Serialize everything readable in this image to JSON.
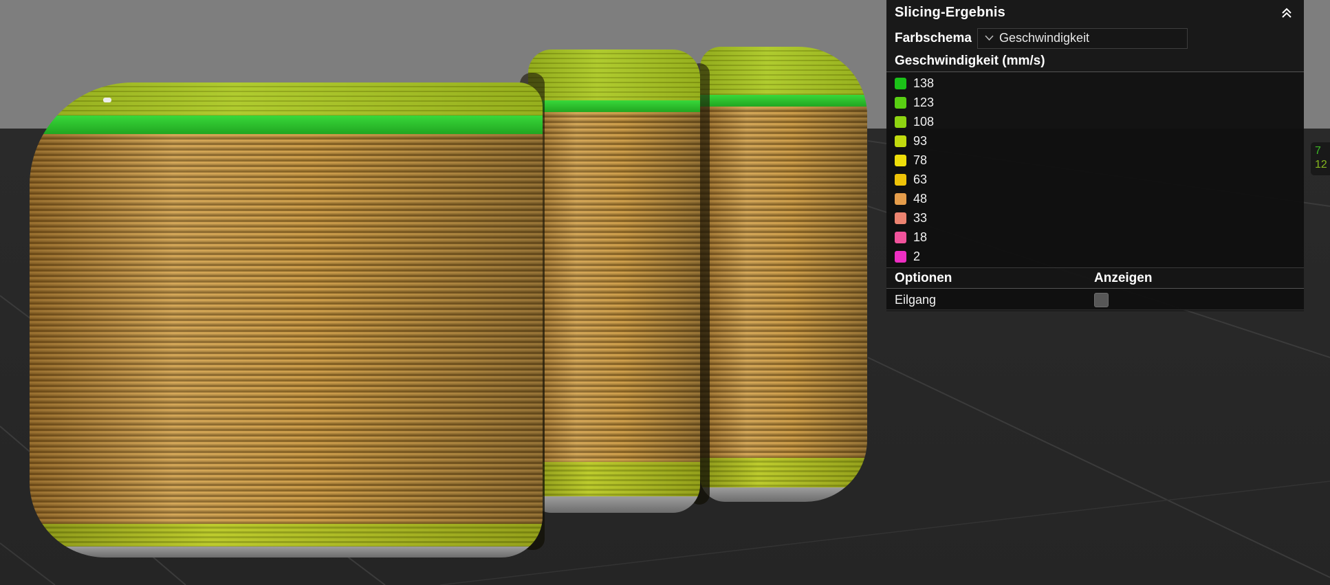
{
  "viewport": {
    "upper_background": "#7e7e7e",
    "floor_background": "#272727",
    "grid_line_color": "#3b3b3b",
    "model_palette": {
      "top_surface": "#a9c51f",
      "rim_band": "#2dc72e",
      "body": "#c69943",
      "body_shadow": "#8a6526",
      "foot_band": "#b7c41f",
      "base": "#8f8f8f"
    }
  },
  "panel": {
    "title": "Slicing-Ergebnis",
    "farbschema_label": "Farbschema",
    "farbschema_value": "Geschwindigkeit",
    "legend_title": "Geschwindigkeit (mm/s)",
    "legend": [
      {
        "color": "#1bc218",
        "value": "138"
      },
      {
        "color": "#59cf13",
        "value": "123"
      },
      {
        "color": "#8ed411",
        "value": "108"
      },
      {
        "color": "#c1da0e",
        "value": "93"
      },
      {
        "color": "#eede0a",
        "value": "78"
      },
      {
        "color": "#eec308",
        "value": "63"
      },
      {
        "color": "#e59d4b",
        "value": "48"
      },
      {
        "color": "#ec8370",
        "value": "33"
      },
      {
        "color": "#f0539b",
        "value": "18"
      },
      {
        "color": "#ee2fc3",
        "value": "2"
      }
    ],
    "options_label": "Optionen",
    "anzeigen_label": "Anzeigen",
    "options": [
      {
        "label": "Eilgang",
        "checked": false
      }
    ]
  },
  "edge_badge": {
    "line1": "7",
    "line2": "12"
  }
}
